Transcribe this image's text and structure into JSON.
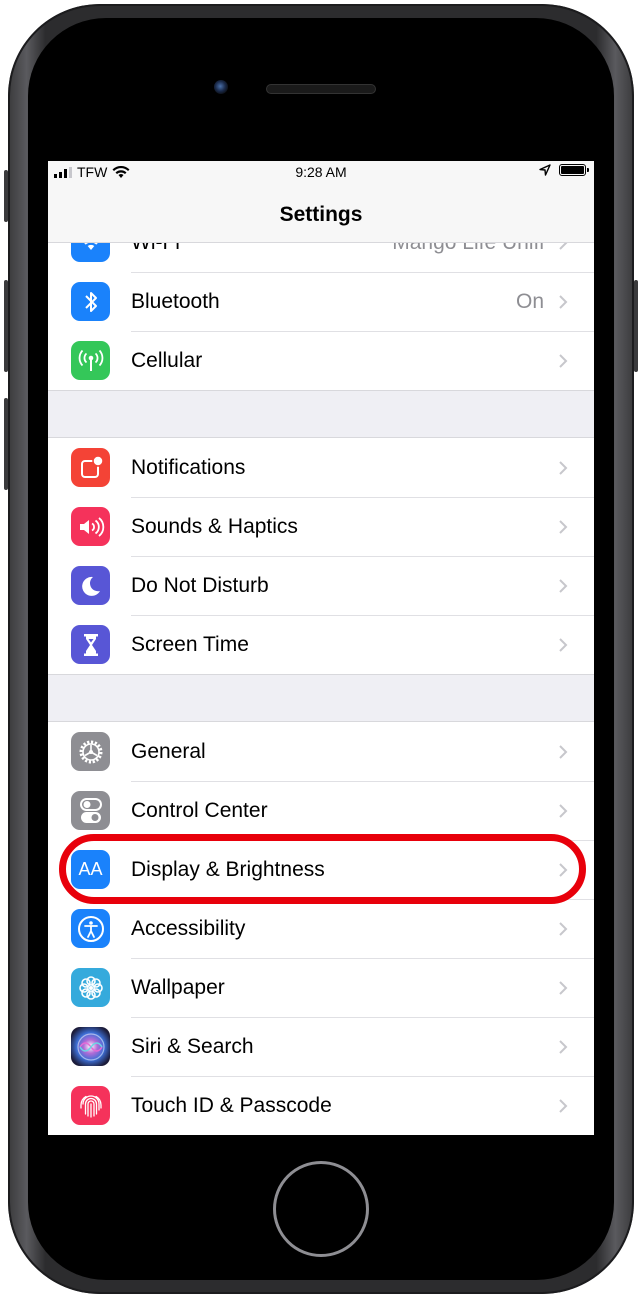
{
  "status_bar": {
    "carrier": "TFW",
    "time": "9:28 AM",
    "icons": [
      "signal-bars-icon",
      "wifi-icon",
      "location-arrow-icon",
      "battery-icon"
    ]
  },
  "nav": {
    "title": "Settings"
  },
  "groups": [
    {
      "items": [
        {
          "label": "Wi-Fi",
          "value": "Mango Life Unifi",
          "icon": "wifi-icon",
          "color": "#1a82fb"
        },
        {
          "label": "Bluetooth",
          "value": "On",
          "icon": "bluetooth-icon",
          "color": "#1a82fb"
        },
        {
          "label": "Cellular",
          "value": "",
          "icon": "cellular-antenna-icon",
          "color": "#34c759"
        }
      ]
    },
    {
      "items": [
        {
          "label": "Notifications",
          "value": "",
          "icon": "notifications-icon",
          "color": "#f44336"
        },
        {
          "label": "Sounds & Haptics",
          "value": "",
          "icon": "speaker-icon",
          "color": "#f5325b"
        },
        {
          "label": "Do Not Disturb",
          "value": "",
          "icon": "moon-icon",
          "color": "#5856d6"
        },
        {
          "label": "Screen Time",
          "value": "",
          "icon": "hourglass-icon",
          "color": "#5856d6"
        }
      ]
    },
    {
      "items": [
        {
          "label": "General",
          "value": "",
          "icon": "gear-icon",
          "color": "#8e8e93"
        },
        {
          "label": "Control Center",
          "value": "",
          "icon": "toggles-icon",
          "color": "#8e8e93"
        },
        {
          "label": "Display & Brightness",
          "value": "",
          "icon": "text-size-icon",
          "color": "#1a82fb",
          "glyph": "AA",
          "highlighted": true
        },
        {
          "label": "Accessibility",
          "value": "",
          "icon": "accessibility-icon",
          "color": "#1a82fb"
        },
        {
          "label": "Wallpaper",
          "value": "",
          "icon": "flower-icon",
          "color": "#35aadc"
        },
        {
          "label": "Siri & Search",
          "value": "",
          "icon": "siri-icon",
          "color": "#1c1c3a"
        },
        {
          "label": "Touch ID & Passcode",
          "value": "",
          "icon": "fingerprint-icon",
          "color": "#f5325b"
        }
      ]
    }
  ],
  "annotation": {
    "highlight_color": "#e8000b",
    "target": "Display & Brightness"
  }
}
